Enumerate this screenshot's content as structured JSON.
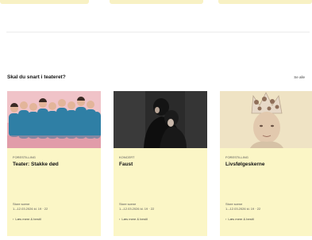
{
  "section": {
    "title": "Skal du snart i teateret?",
    "see_all": "Se alle"
  },
  "cards": [
    {
      "category": "FORESTILLING",
      "title": "Teater: Stakke død",
      "venue": "Store scene",
      "dates": "1.–12.03.2026 kl. 19 · 22",
      "link": "Læs mere & bestil",
      "image_icon": "ensemble-photo"
    },
    {
      "category": "KONCERT",
      "title": "Faust",
      "venue": "Store scene",
      "dates": "1.–12.03.2026 kl. 19 · 22",
      "link": "Læs mere & bestil",
      "image_icon": "faust-photo"
    },
    {
      "category": "FORESTILLING",
      "title": "Livsfølgeskerne",
      "venue": "Store scene",
      "dates": "1.–12.03.2026 kl. 19 · 22",
      "link": "Læs mere & bestil",
      "image_icon": "crown-portrait-photo"
    }
  ],
  "colors": {
    "card_bg": "#fbf6c6",
    "accent_strip": "#f8f1c4"
  }
}
